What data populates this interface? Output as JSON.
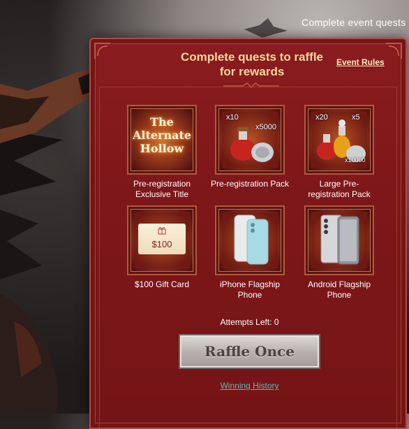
{
  "banner": {
    "text": "Complete event quests"
  },
  "panel": {
    "title_line1": "Complete quests to raffle",
    "title_line2": "for rewards",
    "event_rules": "Event Rules"
  },
  "rewards": [
    {
      "label_line1": "Pre-registration",
      "label_line2": "Exclusive Title",
      "art_text": [
        "The",
        "Alternate",
        "Hollow"
      ]
    },
    {
      "label_line1": "Pre-registration Pack",
      "label_line2": "",
      "counts": [
        "x10",
        "x5000"
      ]
    },
    {
      "label_line1": "Large Pre-",
      "label_line2": "registration Pack",
      "counts": [
        "x20",
        "x5",
        "x10000"
      ]
    },
    {
      "label_line1": "$100 Gift Card",
      "label_line2": "",
      "card_amount": "$100"
    },
    {
      "label_line1": "iPhone Flagship",
      "label_line2": "Phone"
    },
    {
      "label_line1": "Android Flagship",
      "label_line2": "Phone"
    }
  ],
  "attempts": {
    "text": "Attempts Left: 0"
  },
  "raffle_button": {
    "label": "Raffle Once"
  },
  "winning_history": {
    "label": "Winning History"
  },
  "colors": {
    "panel_red": "#7e1719",
    "title_gold": "#f7d9a1",
    "link_teal": "#5fb9b6",
    "button_gray": "#b9b3b0"
  }
}
